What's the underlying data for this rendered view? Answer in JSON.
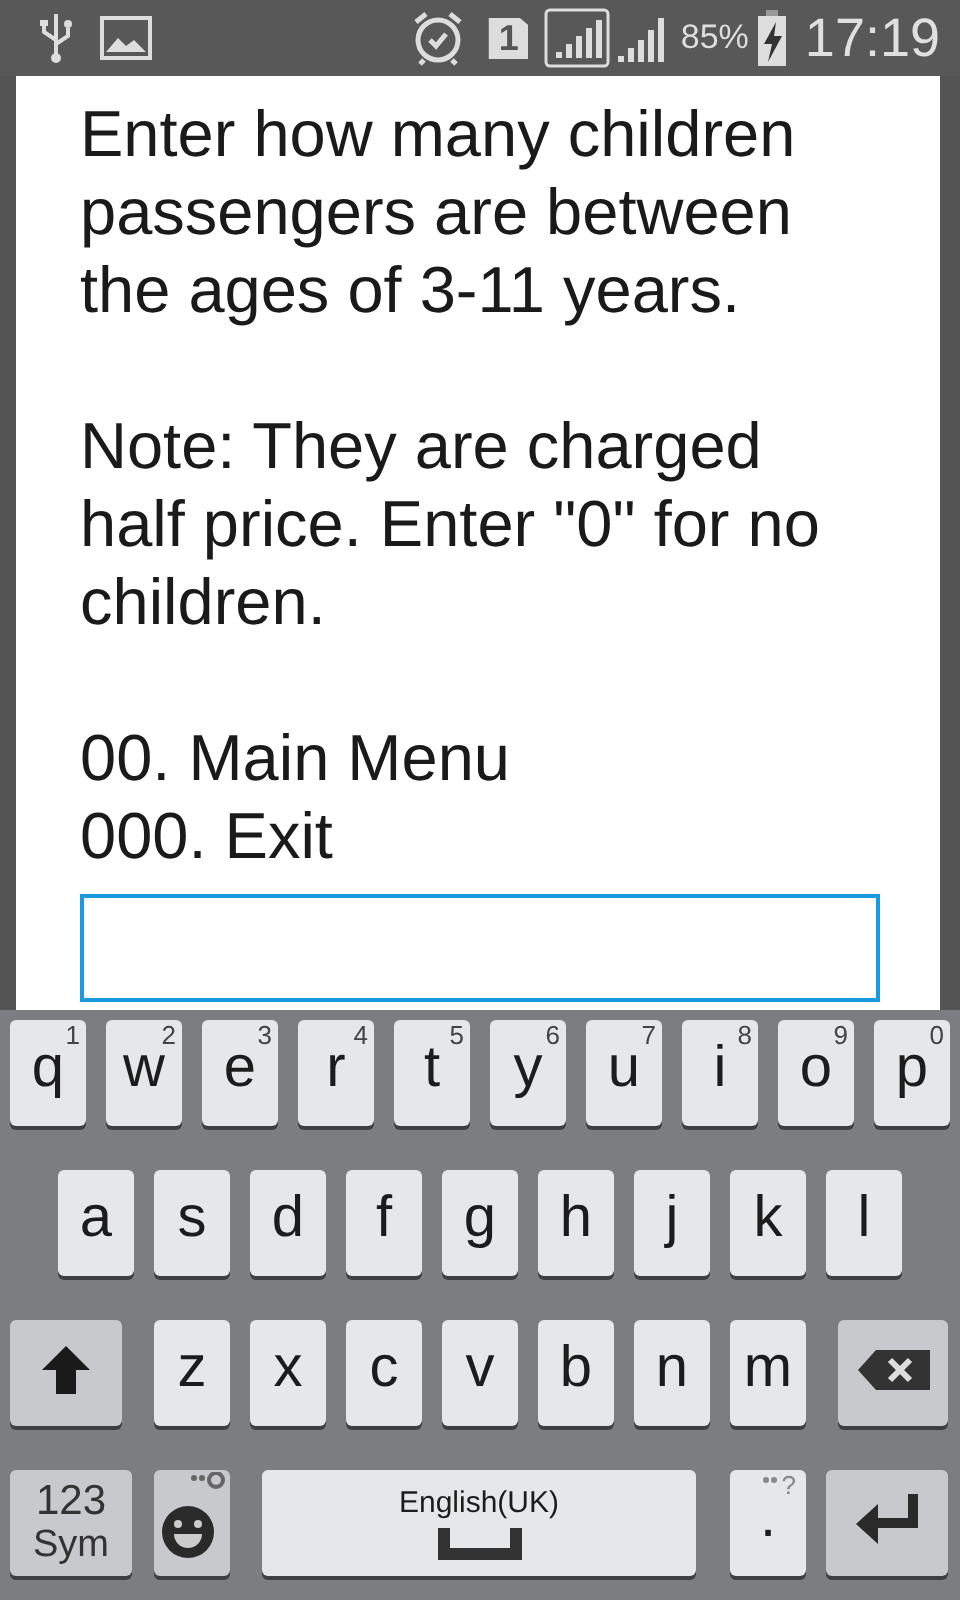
{
  "status_bar": {
    "sim_slot": "1",
    "battery": "85%",
    "time": "17:19"
  },
  "dialog": {
    "prompt": "Enter how many children passengers are between the ages of 3-11 years.",
    "note": "Note: They are charged half price. Enter \"0\" for no children.",
    "options": [
      "00. Main Menu",
      "000. Exit"
    ]
  },
  "keyboard": {
    "letter_row": [
      {
        "kind": "letter",
        "label": "q",
        "hint": "1"
      },
      {
        "kind": "letter",
        "label": "w",
        "hint": "2"
      },
      {
        "kind": "letter",
        "label": "e",
        "hint": "3"
      },
      {
        "kind": "letter",
        "label": "r",
        "hint": "4"
      },
      {
        "kind": "letter",
        "label": "t",
        "hint": "5"
      },
      {
        "kind": "letter",
        "label": "y",
        "hint": "6"
      },
      {
        "kind": "letter",
        "label": "u",
        "hint": "7"
      },
      {
        "kind": "letter",
        "label": "i",
        "hint": "8"
      },
      {
        "kind": "letter",
        "label": "o",
        "hint": "9"
      },
      {
        "kind": "letter",
        "label": "p",
        "hint": "0"
      }
    ],
    "home_row": [
      {
        "kind": "letter",
        "label": "a"
      },
      {
        "kind": "letter",
        "label": "s"
      },
      {
        "kind": "letter",
        "label": "d"
      },
      {
        "kind": "letter",
        "label": "f"
      },
      {
        "kind": "letter",
        "label": "g"
      },
      {
        "kind": "letter",
        "label": "h"
      },
      {
        "kind": "letter",
        "label": "j"
      },
      {
        "kind": "letter",
        "label": "k"
      },
      {
        "kind": "letter",
        "label": "l"
      }
    ],
    "shift_row": [
      {
        "kind": "shift"
      },
      {
        "kind": "letter",
        "label": "z"
      },
      {
        "kind": "letter",
        "label": "x"
      },
      {
        "kind": "letter",
        "label": "c"
      },
      {
        "kind": "letter",
        "label": "v"
      },
      {
        "kind": "letter",
        "label": "b"
      },
      {
        "kind": "letter",
        "label": "n"
      },
      {
        "kind": "letter",
        "label": "m"
      },
      {
        "kind": "backspace"
      }
    ],
    "function_row": [
      {
        "kind": "sym",
        "label": "123",
        "sublabel": "Sym"
      },
      {
        "kind": "emoji"
      },
      {
        "kind": "space",
        "label": "English(UK)"
      },
      {
        "kind": "period",
        "label": ".",
        "hint": "?"
      },
      {
        "kind": "enter"
      }
    ]
  }
}
